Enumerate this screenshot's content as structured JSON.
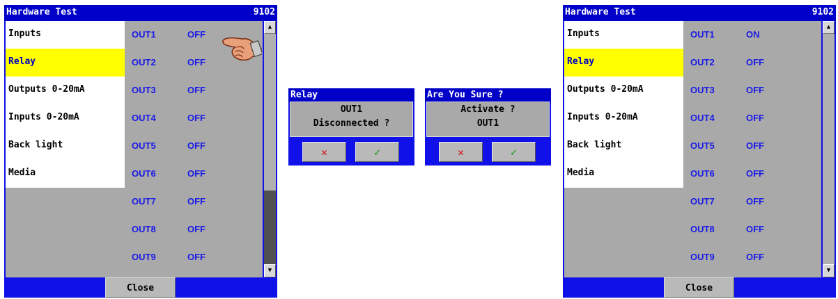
{
  "left_window": {
    "title": "Hardware Test",
    "code": "9102",
    "menu": [
      "Inputs",
      "Relay",
      "Outputs 0-20mA",
      "Inputs 0-20mA",
      "Back light",
      "Media"
    ],
    "selected": "Relay",
    "outputs": [
      {
        "name": "OUT1",
        "state": "OFF"
      },
      {
        "name": "OUT2",
        "state": "OFF"
      },
      {
        "name": "OUT3",
        "state": "OFF"
      },
      {
        "name": "OUT4",
        "state": "OFF"
      },
      {
        "name": "OUT5",
        "state": "OFF"
      },
      {
        "name": "OUT6",
        "state": "OFF"
      },
      {
        "name": "OUT7",
        "state": "OFF"
      },
      {
        "name": "OUT8",
        "state": "OFF"
      },
      {
        "name": "OUT9",
        "state": "OFF"
      }
    ],
    "close_label": "Close"
  },
  "dialog_relay": {
    "title": "Relay",
    "line1": "OUT1",
    "line2": "Disconnected ?",
    "cancel": "✕",
    "ok": "✓"
  },
  "dialog_confirm": {
    "title": "Are You Sure ?",
    "line1": "Activate ?",
    "line2": "OUT1",
    "cancel": "✕",
    "ok": "✓"
  },
  "right_window": {
    "title": "Hardware Test",
    "code": "9102",
    "menu": [
      "Inputs",
      "Relay",
      "Outputs 0-20mA",
      "Inputs 0-20mA",
      "Back light",
      "Media"
    ],
    "selected": "Relay",
    "outputs": [
      {
        "name": "OUT1",
        "state": "ON"
      },
      {
        "name": "OUT2",
        "state": "OFF"
      },
      {
        "name": "OUT3",
        "state": "OFF"
      },
      {
        "name": "OUT4",
        "state": "OFF"
      },
      {
        "name": "OUT5",
        "state": "OFF"
      },
      {
        "name": "OUT6",
        "state": "OFF"
      },
      {
        "name": "OUT7",
        "state": "OFF"
      },
      {
        "name": "OUT8",
        "state": "OFF"
      },
      {
        "name": "OUT9",
        "state": "OFF"
      }
    ],
    "close_label": "Close"
  },
  "icons": {
    "scroll_up": "scroll-up-arrow-icon",
    "scroll_down": "scroll-down-arrow-icon",
    "pointer": "pointing-hand-icon",
    "cancel": "cancel-x-icon",
    "confirm": "check-mark-icon"
  },
  "colors": {
    "window_blue": "#1010e8",
    "title_blue": "#0000c8",
    "selection_yellow": "#ffff00",
    "panel_gray": "#a9a9a9",
    "output_text_blue": "#1a1ae8"
  },
  "scrollbar": {
    "left_thumb_top_fraction": 0.68,
    "right_thumb_top_fraction": 0.0
  }
}
